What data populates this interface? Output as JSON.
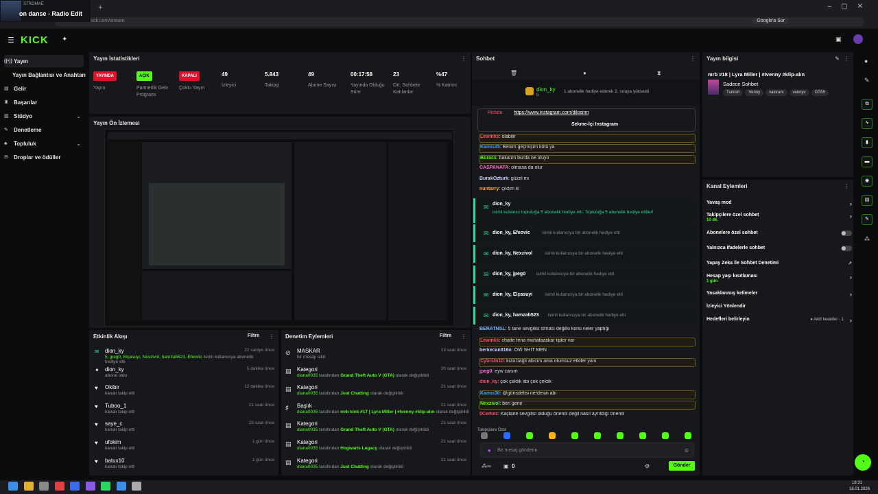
{
  "browser": {
    "media_artist": "STROMAE",
    "media_title": "on danse - Radio Edit",
    "url": "dashboard.kick.com/stream",
    "google_btn": "Google'a Sor"
  },
  "logo": "KICK",
  "sidebar": {
    "items": [
      {
        "label": "Yayın",
        "icon": "broadcast-icon",
        "chev": ""
      },
      {
        "label": "Yayın Bağlantısı ve Anahtarı",
        "icon": "",
        "chev": ""
      },
      {
        "label": "Gelir",
        "icon": "wallet-icon",
        "chev": ""
      },
      {
        "label": "Başarılar",
        "icon": "trophy-icon",
        "chev": ""
      },
      {
        "label": "Stüdyo",
        "icon": "studio-icon",
        "chev": "⌄"
      },
      {
        "label": "Denetleme",
        "icon": "wrench-icon",
        "chev": ""
      },
      {
        "label": "Topluluk",
        "icon": "community-icon",
        "chev": "⌄"
      },
      {
        "label": "Droplar ve ödüller",
        "icon": "gift-icon",
        "chev": ""
      }
    ]
  },
  "stats": {
    "title": "Yayın İstatistikleri",
    "items": [
      {
        "value": "YAYINDA",
        "label": "Yayın",
        "badge_color": "#e0102a"
      },
      {
        "value": "AÇIK",
        "label": "Partnerlik Gelir Programı",
        "badge_color": "#53fc18"
      },
      {
        "value": "KAPALI",
        "label": "Çoklu Yayın",
        "badge_color": "#e0102a"
      },
      {
        "value": "49",
        "label": "İzleyici"
      },
      {
        "value": "5.843",
        "label": "Takipçi"
      },
      {
        "value": "49",
        "label": "Abone Sayısı"
      },
      {
        "value": "00:17:58",
        "label": "Yayında Olduğu Süre"
      },
      {
        "value": "23",
        "label": "Ort. Sohbete Katılanlar"
      },
      {
        "value": "%47",
        "label": "% Katılım"
      }
    ]
  },
  "preview": {
    "title": "Yayın Ön İzlemesi"
  },
  "activity": {
    "title": "Etkinlik Akışı",
    "filter": "Filtre",
    "items": [
      {
        "icon": "gift-icon",
        "name": "dion_ky",
        "detail_names": "5, jpeg0, Elçasuyi, Nexzivol, hamzab523, Efeovic",
        "detail": "isimli kullanıcıya abonelik hediye etti",
        "time": "22 saniye önce"
      },
      {
        "icon": "star-icon",
        "name": "dion_ky",
        "detail_names": "",
        "detail": "abone oldu",
        "time": "5 dakika önce"
      },
      {
        "icon": "heart-icon",
        "name": "Okibir",
        "detail_names": "",
        "detail": "kanalı takip etti",
        "time": "12 dakika önce"
      },
      {
        "icon": "heart-icon",
        "name": "Tuboo_1",
        "detail_names": "",
        "detail": "kanalı takip etti",
        "time": "21 saat önce"
      },
      {
        "icon": "heart-icon",
        "name": "saye_c",
        "detail_names": "",
        "detail": "kanalı takip etti",
        "time": "23 saat önce"
      },
      {
        "icon": "heart-icon",
        "name": "ufokim",
        "detail_names": "",
        "detail": "kanalı takip etti",
        "time": "1 gün önce"
      },
      {
        "icon": "heart-icon",
        "name": "batux10",
        "detail_names": "",
        "detail": "kanalı takip etti",
        "time": "1 gün önce"
      }
    ]
  },
  "moderation": {
    "title": "Denetim Eylemleri",
    "filter": "Filtre",
    "items": [
      {
        "icon": "ban-icon",
        "title": "MASKAR",
        "who": "",
        "mid": "bir mesajı sildi",
        "what": "",
        "tail": "",
        "time": "19 saat önce"
      },
      {
        "icon": "category-icon",
        "title": "Kategori",
        "who": "diana0035",
        "mid": " tarafından ",
        "what": "Grand Theft Auto V (GTA)",
        "tail": " olarak değiştirildi",
        "time": "20 saat önce"
      },
      {
        "icon": "category-icon",
        "title": "Kategori",
        "who": "diana0035",
        "mid": " tarafından ",
        "what": "Just Chatting",
        "tail": " olarak değiştirildi",
        "time": "21 saat önce"
      },
      {
        "icon": "title-icon",
        "title": "Başlık",
        "who": "diana0035",
        "mid": " tarafından ",
        "what": "mrb kink #17 | Lyra Miller | #Ivenny #klip-alın",
        "tail": " olarak değiştirildi",
        "time": "21 saat önce"
      },
      {
        "icon": "category-icon",
        "title": "Kategori",
        "who": "diana0035",
        "mid": " tarafından ",
        "what": "Grand Theft Auto V (GTA)",
        "tail": " olarak değiştirildi",
        "time": "21 saat önce"
      },
      {
        "icon": "category-icon",
        "title": "Kategori",
        "who": "diana0035",
        "mid": " tarafından ",
        "what": "Hogwarts Legacy",
        "tail": " olarak değiştirildi",
        "time": "21 saat önce"
      },
      {
        "icon": "category-icon",
        "title": "Kategori",
        "who": "diana0035",
        "mid": " tarafından ",
        "what": "Just Chatting",
        "tail": " olarak değiştirildi",
        "time": "21 saat önce"
      }
    ]
  },
  "chat": {
    "title": "Sohbet",
    "pinned_user": "dion_ky",
    "pinned_sub": "5",
    "pinned_text": "1 abonelik hediye ederek 2. sıraya yükseldi",
    "link_user": "Rickdu",
    "link_url": "https://www.instagram.com/dilosinn",
    "link_btn": "Sekme-İçi Instagram",
    "messages_top": [
      {
        "user": "Lewinks",
        "text": ": olabilir",
        "color": "#ff4d6a",
        "hl": true
      },
      {
        "user": "Kamis35",
        "text": ": Benim geçmişim kötü ya",
        "color": "#3aa7ff",
        "hl": true
      },
      {
        "user": "Boracs",
        "text": ": bakalım burda ne oluyo",
        "color": "#53fc18",
        "hl": true
      },
      {
        "user": "CASPANATA",
        "text": ": olmasa da olur",
        "color": "#ff6bd0",
        "hl": false
      },
      {
        "user": "BurakOzturk",
        "text": ": güzel mi",
        "color": "#c7d0ff",
        "hl": false
      },
      {
        "user": "nuntarry",
        "text": ": çıktım kl",
        "color": "#ffb020",
        "hl": false
      }
    ],
    "gifts": [
      {
        "user": "dion_ky",
        "text": "isimli kullanıcı topluluğa 5 abonelik hediye etti. Topluluğa 5 abonelik hediye ettiler!"
      },
      {
        "user": "dion_ky, Efeovic",
        "text": "isimli kullanıcıya bir abonelik hediye etti"
      },
      {
        "user": "dion_ky, Nexzivol",
        "text": "isimli kullanıcıya bir abonelik hediye etti"
      },
      {
        "user": "dion_ky, jpeg0",
        "text": "isimli kullanıcıya bir abonelik hediye etti"
      },
      {
        "user": "dion_ky, Elçasuyi",
        "text": "isimli kullanıcıya bir abonelik hediye etti"
      },
      {
        "user": "dion_ky, hamzab523",
        "text": "isimli kullanıcıya bir abonelik hediye etti"
      }
    ],
    "messages_bottom": [
      {
        "user": "BERATNSL",
        "text": ": 5 tane sevgilisi olması değilki konu neler yaptığı",
        "color": "#7ab8ff",
        "hl": false
      },
      {
        "user": "Lewinks",
        "text": ": chatte fena muhafazakar tipler var",
        "color": "#ff4d6a",
        "hl": true
      },
      {
        "user": "berkecan316n",
        "text": ": OW SHİT MEN",
        "color": "#c7d0ff",
        "hl": false
      },
      {
        "user": "Cybrstn10",
        "text": ": kıza bağlı abicim ama olumsuz etkiler yani",
        "color": "#ff4d6a",
        "hl": true
      },
      {
        "user": "jpeg0",
        "text": ": eyw canım",
        "color": "#ff6bd0",
        "hl": false
      },
      {
        "user": "dion_ky",
        "text": ": çok çektik abi çok çektik",
        "color": "#ff4d6a",
        "hl": false
      },
      {
        "user": "Kamis30",
        "text": ": @gönsdelisi nerdesin abi",
        "color": "#3aa7ff",
        "hl": true
      },
      {
        "user": "Nexzivol",
        "text": ": ben gene",
        "color": "#53fc18",
        "hl": true
      },
      {
        "user": "0Cerkez",
        "text": ": Kaçtane sevgilisi olduğu önemli değil nasıl ayrıldığı önemli",
        "color": "#ff4d6a",
        "hl": false
      }
    ],
    "followers_only": "Takipçilere Özel",
    "input_placeholder": "Bir mesaj gönderin",
    "send": "Gönder",
    "count": "0",
    "emote_colors": [
      "#777",
      "#2a6cff",
      "#53fc18",
      "#ffb020",
      "#53fc18",
      "#53fc18",
      "#53fc18",
      "#53fc18",
      "#53fc18",
      "#53fc18"
    ]
  },
  "info": {
    "title": "Yayın bilgisi",
    "stream_title": "mrb #18 | Lyra Miller | #Ivenny #klip-alın",
    "category": "Sadece Sohbet",
    "tags": [
      "Turkish",
      "Venny",
      "valorant",
      "vennyv",
      "GTA5"
    ]
  },
  "actions": {
    "title": "Kanal Eylemleri",
    "items": [
      {
        "label": "Yavaş mod",
        "sub": "",
        "ctrl": "›"
      },
      {
        "label": "Takipçilere özel sohbet",
        "sub": "10 dk.",
        "ctrl": "›"
      },
      {
        "label": "Abonelere özel sohbet",
        "sub": "",
        "ctrl": "toggle"
      },
      {
        "label": "Yalnızca ifadelerle sohbet",
        "sub": "",
        "ctrl": "toggle"
      },
      {
        "label": "Yapay Zeka ile Sohbet Denetimi",
        "sub": "",
        "ctrl": "↗"
      },
      {
        "label": "Hesap yaşı kısıtlaması",
        "sub": "1 gün",
        "ctrl": "›"
      },
      {
        "label": "Yasaklanmış kelimeler",
        "sub": "",
        "ctrl": "›"
      },
      {
        "label": "İzleyici Yönlendir",
        "sub": "",
        "ctrl": ""
      },
      {
        "label": "Hedefleri belirleyin",
        "sub": "",
        "ctrl": "›",
        "extra": "● Aktif hedefler - 1"
      }
    ]
  },
  "taskbar": {
    "time": "18:31",
    "date": "18.01.2026"
  }
}
